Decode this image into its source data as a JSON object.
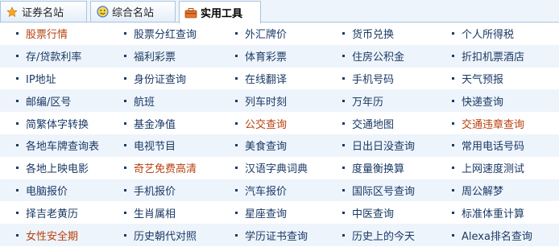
{
  "tabs": [
    {
      "label": "证券名站",
      "icon": "star-icon",
      "active": false
    },
    {
      "label": "综合名站",
      "icon": "smiley-icon",
      "active": false
    },
    {
      "label": "实用工具",
      "icon": "toolbox-icon",
      "active": true
    }
  ],
  "colors": {
    "link": "#1a3a66",
    "highlight": "#b7410e",
    "alt_row": "#eef4fb",
    "border": "#a9c4e1"
  },
  "rows": [
    [
      {
        "text": "股票行情",
        "hl": true
      },
      {
        "text": "股票分红查询"
      },
      {
        "text": "外汇牌价"
      },
      {
        "text": "货币兑换"
      },
      {
        "text": "个人所得税"
      }
    ],
    [
      {
        "text": "存/贷款利率"
      },
      {
        "text": "福利彩票"
      },
      {
        "text": "体育彩票"
      },
      {
        "text": "住房公积金"
      },
      {
        "text": "折扣机票酒店"
      }
    ],
    [
      {
        "text": "IP地址"
      },
      {
        "text": "身份证查询"
      },
      {
        "text": "在线翻译"
      },
      {
        "text": "手机号码"
      },
      {
        "text": "天气预报"
      }
    ],
    [
      {
        "text": "邮编/区号"
      },
      {
        "text": "航班"
      },
      {
        "text": "列车时刻"
      },
      {
        "text": "万年历"
      },
      {
        "text": "快递查询"
      }
    ],
    [
      {
        "text": "简繁体字转换"
      },
      {
        "text": "基金净值"
      },
      {
        "text": "公交查询",
        "hl": true
      },
      {
        "text": "交通地图"
      },
      {
        "text": "交通违章查询",
        "hl": true
      }
    ],
    [
      {
        "text": "各地车牌查询表"
      },
      {
        "text": "电视节目"
      },
      {
        "text": "美食查询"
      },
      {
        "text": "日出日没查询"
      },
      {
        "text": "常用电话号码"
      }
    ],
    [
      {
        "text": "各地上映电影"
      },
      {
        "text": "奇艺免费高清",
        "hl": true
      },
      {
        "text": "汉语字典词典"
      },
      {
        "text": "度量衡换算"
      },
      {
        "text": "上网速度测试"
      }
    ],
    [
      {
        "text": "电脑报价"
      },
      {
        "text": "手机报价"
      },
      {
        "text": "汽车报价"
      },
      {
        "text": "国际区号查询"
      },
      {
        "text": "周公解梦"
      }
    ],
    [
      {
        "text": "择吉老黄历"
      },
      {
        "text": "生肖属相"
      },
      {
        "text": "星座查询"
      },
      {
        "text": "中医查询"
      },
      {
        "text": "标准体重计算"
      }
    ],
    [
      {
        "text": "女性安全期",
        "hl": true
      },
      {
        "text": "历史朝代对照"
      },
      {
        "text": "学历证书查询"
      },
      {
        "text": "历史上的今天"
      },
      {
        "text": "Alexa排名查询"
      }
    ]
  ]
}
